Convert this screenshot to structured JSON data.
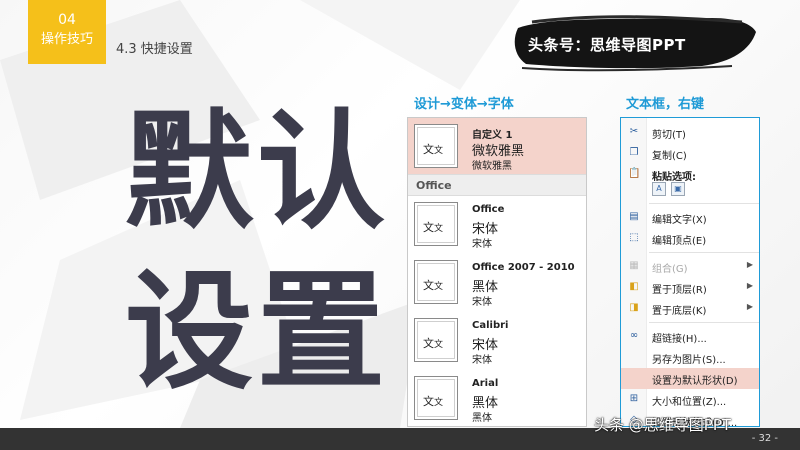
{
  "chapter": {
    "number": "04",
    "name": "操作技巧"
  },
  "section": "4.3 快捷设置",
  "brand": "头条号：思维导图PPT",
  "big_title": {
    "line1": "默认",
    "line2": "设置"
  },
  "captions": {
    "left": "设计→变体→字体",
    "right": "文本框，右键"
  },
  "font_panel": {
    "thumb_text": {
      "big": "文",
      "small": "文"
    },
    "custom": {
      "name": "自定义 1",
      "heading_font": "微软雅黑",
      "body_font": "微软雅黑"
    },
    "group_label": "Office",
    "fonts": [
      {
        "name": "Office",
        "heading_font": "宋体",
        "body_font": "宋体"
      },
      {
        "name": "Office 2007 - 2010",
        "heading_font": "黑体",
        "body_font": "宋体"
      },
      {
        "name": "Calibri",
        "heading_font": "宋体",
        "body_font": "宋体"
      },
      {
        "name": "Arial",
        "heading_font": "黑体",
        "body_font": "黑体"
      }
    ]
  },
  "context_menu": {
    "cut": "剪切(T)",
    "copy": "复制(C)",
    "paste_options": "粘贴选项:",
    "edit_text": "编辑文字(X)",
    "edit_points": "编辑顶点(E)",
    "group": "组合(G)",
    "bring_to_front": "置于顶层(R)",
    "send_to_back": "置于底层(K)",
    "hyperlink": "超链接(H)...",
    "save_as_picture": "另存为图片(S)...",
    "set_default_shape": "设置为默认形状(D)",
    "size_position": "大小和位置(Z)...",
    "format_shape": "设置形状格式(O)..."
  },
  "watermark": "头条 @思维导图PPT",
  "page_number": "- 32 -",
  "colors": {
    "accent_yellow": "#f5c01a",
    "caption_blue": "#1e9ad6",
    "highlight": "#f4d3cb",
    "title_dark": "#3c3c4c"
  }
}
